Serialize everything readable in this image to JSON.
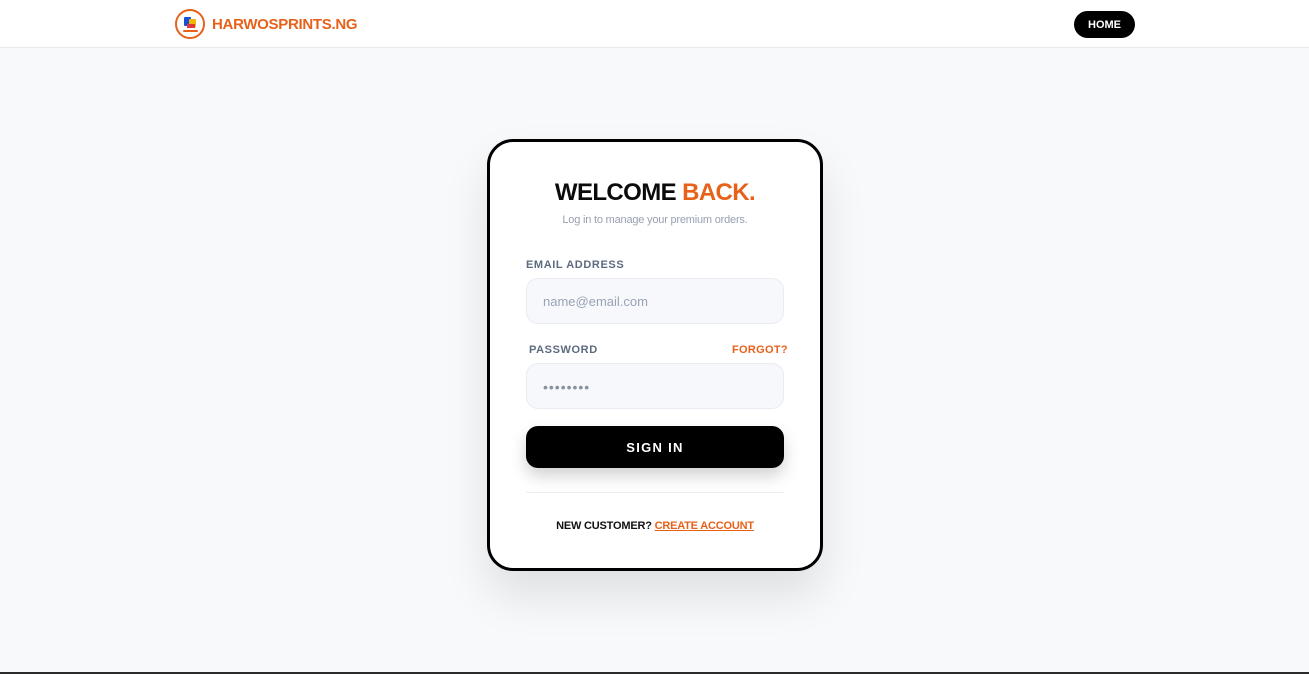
{
  "header": {
    "brand_name": "HARWOSPRINTS.NG",
    "home_label": "HOME"
  },
  "login": {
    "title_main": "WELCOME",
    "title_accent": "BACK.",
    "subtitle": "Log in to manage your premium orders.",
    "email_label": "EMAIL ADDRESS",
    "email_placeholder": "name@email.com",
    "password_label": "PASSWORD",
    "forgot_label": "FORGOT?",
    "password_placeholder": "••••••••",
    "signin_label": "SIGN IN",
    "new_customer_text": "NEW CUSTOMER?",
    "create_account_label": "CREATE ACCOUNT"
  },
  "colors": {
    "accent": "#e8611a",
    "primary_button": "#000000",
    "background": "#f8f9fb"
  }
}
